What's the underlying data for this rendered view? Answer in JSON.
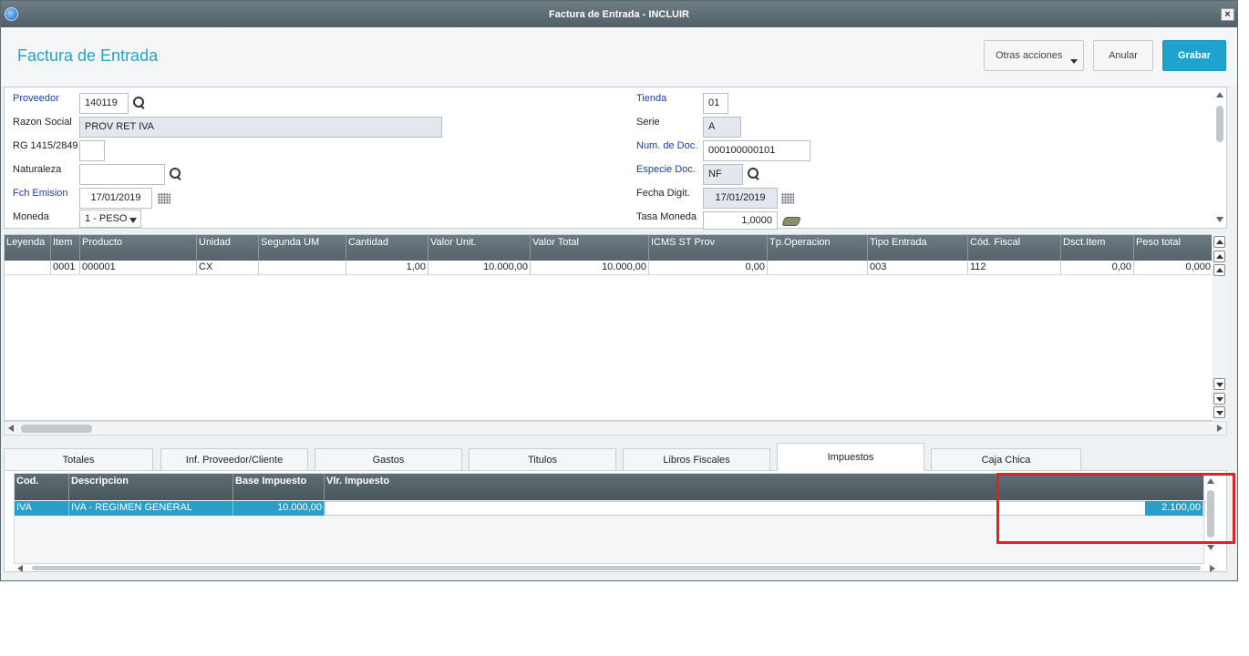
{
  "window": {
    "title": "Factura de Entrada - INCLUIR",
    "close_label": "×"
  },
  "header": {
    "page_title": "Factura de Entrada",
    "more_actions": "Otras acciones",
    "cancel": "Anular",
    "save": "Grabar"
  },
  "form": {
    "proveedor_label": "Proveedor",
    "proveedor_value": "140119",
    "razon_label": "Razon Social",
    "razon_value": "PROV RET IVA",
    "rg_label": "RG 1415/2849",
    "rg_value": "",
    "naturaleza_label": "Naturaleza",
    "naturaleza_value": "",
    "fch_emision_label": "Fch Emision",
    "fch_emision_value": "17/01/2019",
    "moneda_label": "Moneda",
    "moneda_value": "1 - PESO",
    "tienda_label": "Tienda",
    "tienda_value": "01",
    "serie_label": "Serie",
    "serie_value": "A",
    "num_doc_label": "Num. de Doc.",
    "num_doc_value": "000100000101",
    "especie_label": "Especie Doc.",
    "especie_value": "NF",
    "fecha_digit_label": "Fecha Digit.",
    "fecha_digit_value": "17/01/2019",
    "tasa_label": "Tasa Moneda",
    "tasa_value": "1,0000"
  },
  "items_grid": {
    "columns": [
      "Leyenda",
      "Item",
      "Producto",
      "Unidad",
      "Segunda UM",
      "Cantidad",
      "Valor Unit.",
      "Valor Total",
      "ICMS ST Prov",
      "Tp.Operacion",
      "Tipo Entrada",
      "Cód. Fiscal",
      "Dsct.Item",
      "Peso total"
    ],
    "rows": [
      [
        "",
        "0001",
        "000001",
        "CX",
        "",
        "1,00",
        "10.000,00",
        "10.000,00",
        "0,00",
        "",
        "003",
        "112",
        "0,00",
        "0,000"
      ]
    ]
  },
  "tabs": [
    "Totales",
    "Inf. Proveedor/Cliente",
    "Gastos",
    "Titulos",
    "Libros Fiscales",
    "Impuestos",
    "Caja Chica"
  ],
  "tax_grid": {
    "columns": [
      "Cod.",
      "Descripcion",
      "Base Impuesto",
      "Vlr. Impuesto"
    ],
    "rows": [
      [
        "IVA",
        "IVA - REGIMEN GENERAL",
        "10.000,00",
        "2.100,00"
      ]
    ]
  },
  "colors": {
    "accent": "#1da3cd",
    "title": "#2aa2c6",
    "highlight": "#d9242c",
    "required_label": "#1a3ea8"
  }
}
